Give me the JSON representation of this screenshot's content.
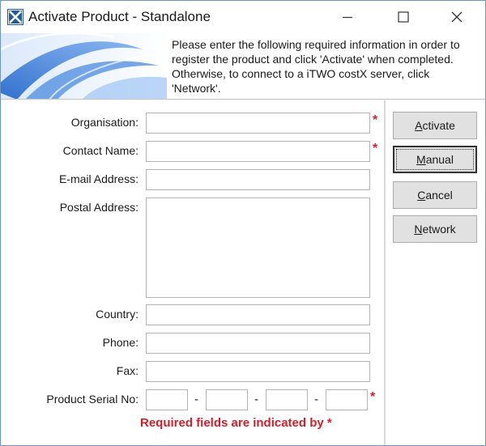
{
  "window": {
    "title": "Activate Product - Standalone",
    "controls": {
      "minimize_icon": "minimize-icon",
      "maximize_icon": "maximize-icon",
      "close_icon": "close-icon"
    }
  },
  "banner": {
    "message": "Please enter the following required information in order to register the product and click 'Activate' when completed. Otherwise, to connect to a iTWO costX server, click 'Network'."
  },
  "form": {
    "organisation_label": "Organisation:",
    "organisation_value": "",
    "contact_name_label": "Contact Name:",
    "contact_name_value": "",
    "email_label": "E-mail Address:",
    "email_value": "",
    "postal_label": "Postal Address:",
    "postal_value": "",
    "country_label": "Country:",
    "country_value": "",
    "phone_label": "Phone:",
    "phone_value": "",
    "fax_label": "Fax:",
    "fax_value": "",
    "serial_label": "Product Serial No:",
    "serial_parts": [
      "",
      "",
      "",
      ""
    ],
    "serial_separator": "-",
    "required_marker": "*",
    "required_note": "Required fields are indicated by *"
  },
  "buttons": {
    "activate": {
      "first": "A",
      "rest": "ctivate"
    },
    "manual": {
      "first": "M",
      "rest": "anual"
    },
    "cancel": {
      "first": "C",
      "rest": "ancel"
    },
    "network": {
      "first": "N",
      "rest": "etwork"
    }
  },
  "colors": {
    "required": "#d21f2a",
    "banner_blue": "#2f6fc4",
    "window_border": "#6f94c2"
  }
}
